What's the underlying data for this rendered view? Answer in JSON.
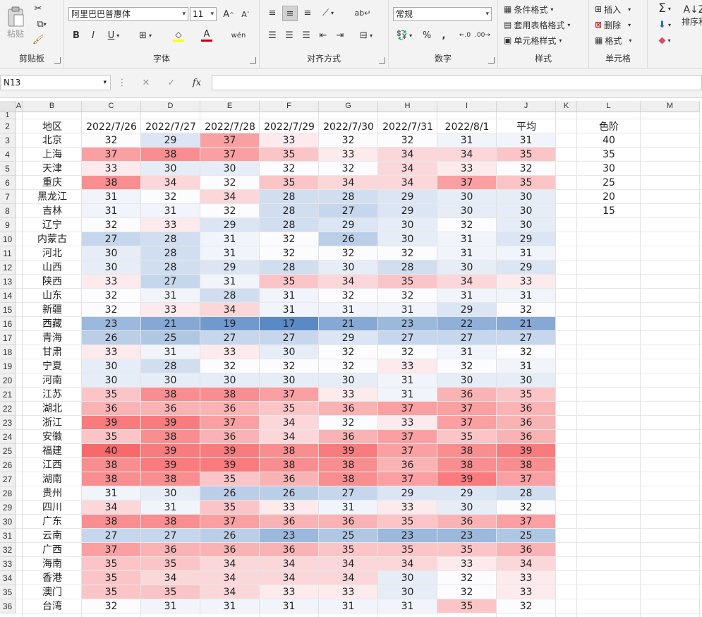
{
  "ribbon": {
    "clipboard": {
      "label": "剪贴板",
      "paste": "粘贴"
    },
    "font": {
      "label": "字体",
      "family": "阿里巴巴普惠体",
      "size": "11",
      "bold": "B",
      "italic": "I",
      "underline": "U",
      "wen": "wén"
    },
    "align": {
      "label": "对齐方式"
    },
    "number": {
      "label": "数字",
      "format": "常规",
      "percent": "%",
      "comma": ","
    },
    "styles": {
      "label": "样式",
      "conditional": "条件格式",
      "table": "套用表格格式",
      "cell": "单元格样式"
    },
    "cells": {
      "label": "单元格",
      "insert": "插入",
      "delete": "删除",
      "format": "格式"
    },
    "editing": {
      "sort": "排序和"
    }
  },
  "formula_bar": {
    "name_box": "N13",
    "fx": "fx",
    "cancel": "✕",
    "enter": "✓",
    "value": ""
  },
  "columns": [
    "A",
    "B",
    "C",
    "D",
    "E",
    "F",
    "G",
    "H",
    "I",
    "J",
    "K",
    "L",
    "M"
  ],
  "rows": [
    "1",
    "2",
    "3",
    "4",
    "5",
    "6",
    "7",
    "8",
    "9",
    "10",
    "11",
    "12",
    "13",
    "14",
    "15",
    "16",
    "17",
    "18",
    "19",
    "20",
    "21",
    "22",
    "23",
    "24",
    "25",
    "26",
    "27",
    "28",
    "29",
    "30",
    "31",
    "32",
    "33",
    "34",
    "35",
    "36"
  ],
  "sheet": {
    "header": {
      "region": "地区",
      "dates": [
        "2022/7/26",
        "2022/7/27",
        "2022/7/28",
        "2022/7/29",
        "2022/7/30",
        "2022/7/31",
        "2022/8/1"
      ],
      "avg": "平均"
    },
    "legend_title": "色阶",
    "legend_values": [
      "40",
      "35",
      "30",
      "25",
      "20",
      "15"
    ],
    "data": [
      [
        "北京",
        32,
        29,
        37,
        33,
        32,
        32,
        31,
        31
      ],
      [
        "上海",
        37,
        38,
        37,
        35,
        33,
        34,
        34,
        35
      ],
      [
        "天津",
        33,
        30,
        30,
        32,
        32,
        34,
        33,
        32
      ],
      [
        "重庆",
        38,
        34,
        32,
        35,
        34,
        34,
        37,
        35
      ],
      [
        "黑龙江",
        31,
        32,
        34,
        28,
        28,
        29,
        30,
        30
      ],
      [
        "吉林",
        31,
        31,
        32,
        28,
        27,
        29,
        30,
        30
      ],
      [
        "辽宁",
        32,
        33,
        29,
        28,
        29,
        30,
        32,
        30
      ],
      [
        "内蒙古",
        27,
        28,
        31,
        32,
        26,
        30,
        31,
        29
      ],
      [
        "河北",
        30,
        28,
        31,
        32,
        32,
        32,
        31,
        31
      ],
      [
        "山西",
        30,
        28,
        29,
        28,
        30,
        28,
        30,
        29
      ],
      [
        "陕西",
        33,
        27,
        31,
        35,
        34,
        35,
        34,
        33
      ],
      [
        "山东",
        32,
        31,
        28,
        31,
        32,
        32,
        31,
        31
      ],
      [
        "新疆",
        32,
        33,
        34,
        31,
        31,
        31,
        29,
        32
      ],
      [
        "西藏",
        23,
        21,
        19,
        17,
        21,
        23,
        22,
        21
      ],
      [
        "青海",
        26,
        25,
        27,
        27,
        29,
        27,
        27,
        27
      ],
      [
        "甘肃",
        33,
        31,
        33,
        30,
        32,
        32,
        31,
        32
      ],
      [
        "宁夏",
        30,
        28,
        32,
        32,
        32,
        33,
        32,
        31
      ],
      [
        "河南",
        30,
        30,
        30,
        30,
        30,
        31,
        30,
        30
      ],
      [
        "江苏",
        35,
        38,
        38,
        37,
        33,
        31,
        36,
        35
      ],
      [
        "湖北",
        36,
        36,
        36,
        35,
        36,
        37,
        37,
        36
      ],
      [
        "浙江",
        39,
        39,
        37,
        34,
        32,
        33,
        37,
        36
      ],
      [
        "安徽",
        35,
        38,
        36,
        34,
        36,
        37,
        35,
        36
      ],
      [
        "福建",
        40,
        39,
        39,
        38,
        39,
        37,
        38,
        39
      ],
      [
        "江西",
        38,
        39,
        39,
        38,
        38,
        36,
        38,
        38
      ],
      [
        "湖南",
        38,
        38,
        35,
        36,
        38,
        37,
        39,
        37
      ],
      [
        "贵州",
        31,
        30,
        26,
        26,
        27,
        29,
        29,
        28
      ],
      [
        "四川",
        34,
        31,
        35,
        33,
        31,
        33,
        30,
        32
      ],
      [
        "广东",
        38,
        38,
        37,
        36,
        36,
        35,
        36,
        37
      ],
      [
        "云南",
        27,
        27,
        26,
        23,
        25,
        23,
        23,
        25
      ],
      [
        "广西",
        37,
        36,
        36,
        36,
        35,
        35,
        35,
        36
      ],
      [
        "海南",
        35,
        35,
        34,
        34,
        34,
        34,
        33,
        34
      ],
      [
        "香港",
        35,
        34,
        34,
        34,
        34,
        30,
        32,
        33
      ],
      [
        "澳门",
        35,
        35,
        34,
        33,
        33,
        30,
        32,
        33
      ],
      [
        "台湾",
        32,
        31,
        31,
        31,
        31,
        31,
        35,
        32
      ]
    ],
    "scale_colors": {
      "low": "#5a8ac6",
      "mid": "#fcfcff",
      "high": "#f8696b"
    }
  }
}
